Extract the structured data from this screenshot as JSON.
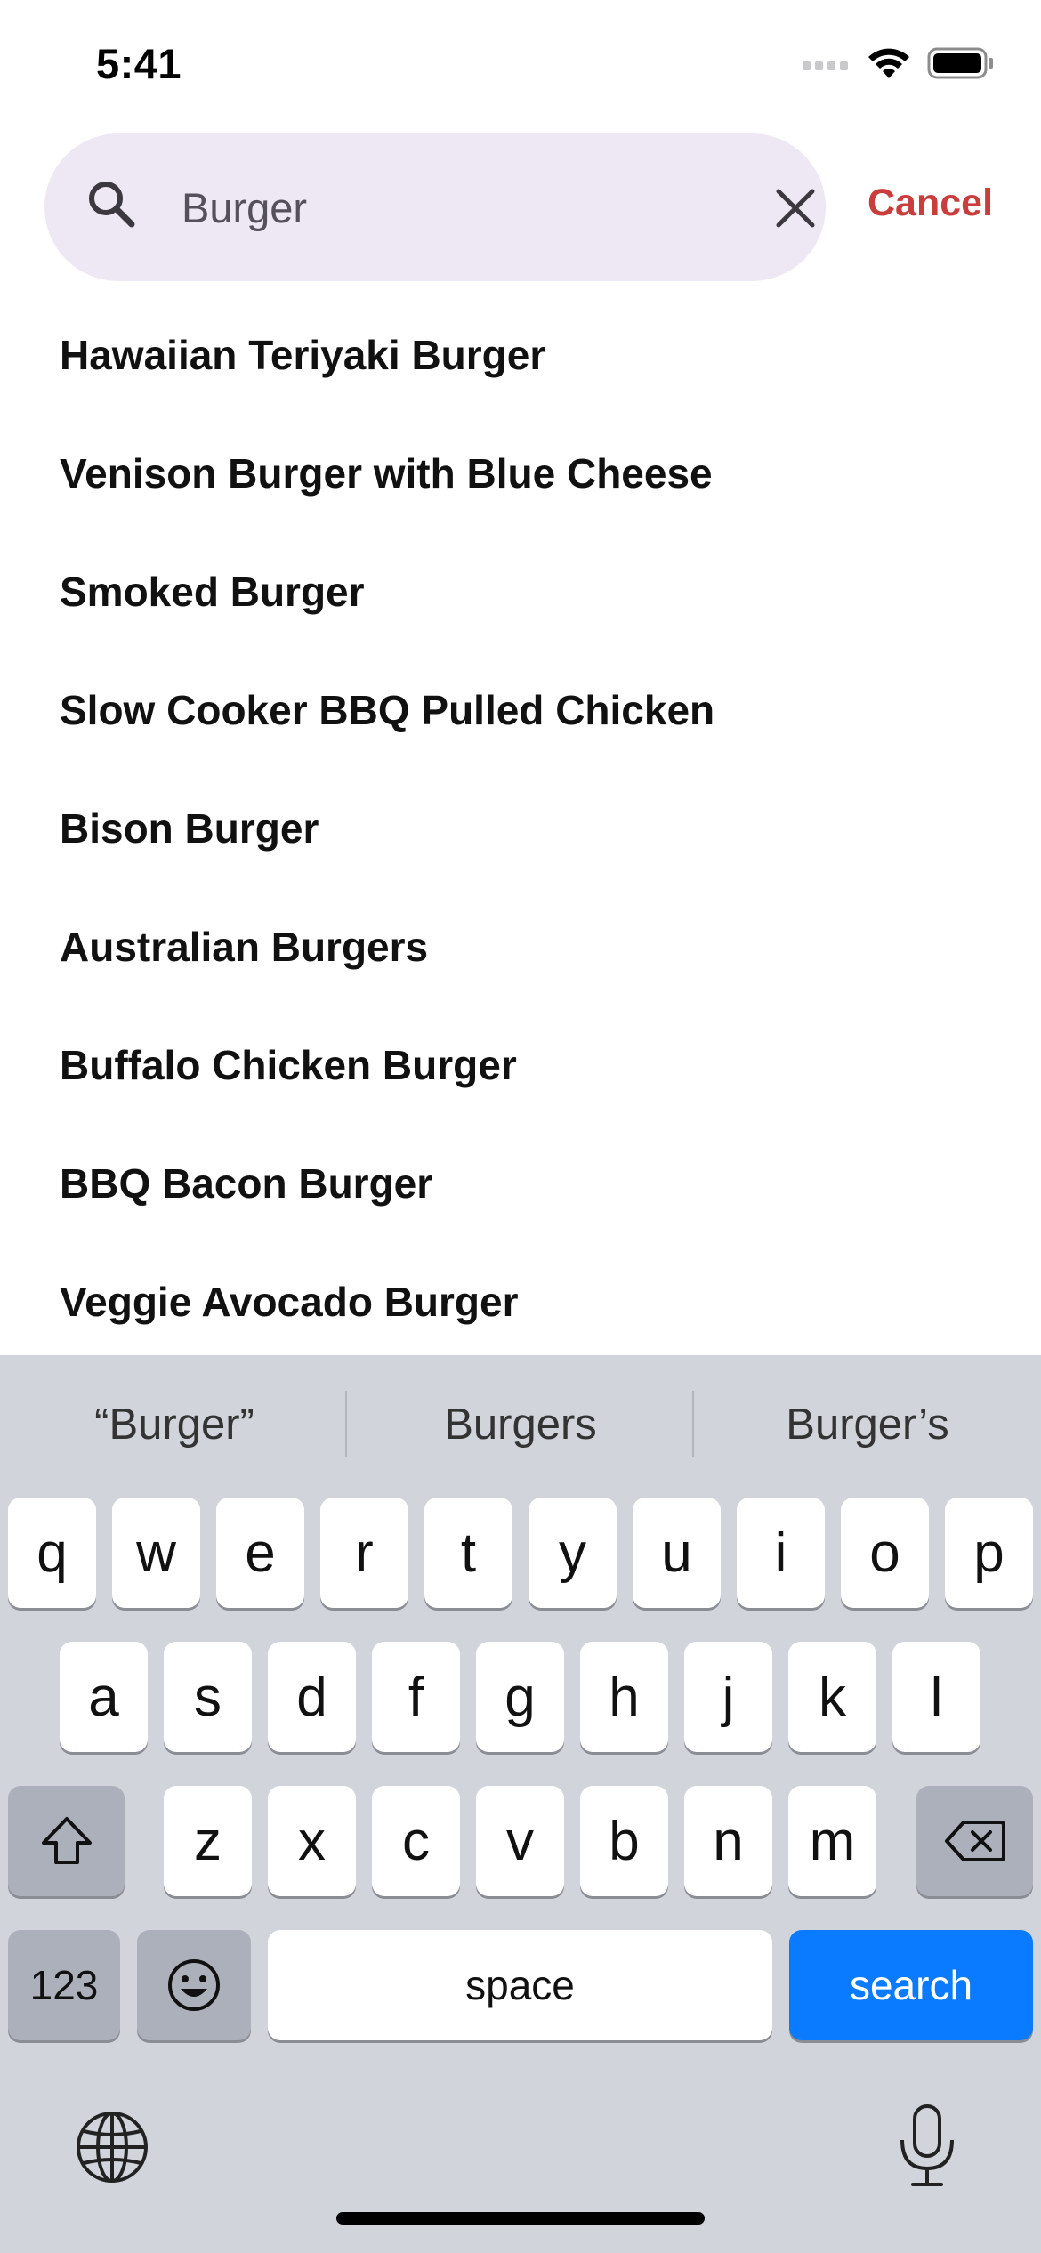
{
  "status": {
    "time": "5:41"
  },
  "search": {
    "query": "Burger",
    "cancel_label": "Cancel"
  },
  "results": [
    "Hawaiian Teriyaki Burger",
    "Venison Burger with Blue Cheese",
    "Smoked Burger",
    "Slow Cooker BBQ Pulled Chicken",
    "Bison Burger",
    "Australian Burgers",
    "Buffalo Chicken Burger",
    "BBQ Bacon Burger",
    "Veggie Avocado Burger"
  ],
  "keyboard": {
    "suggestions": [
      "“Burger”",
      "Burgers",
      "Burger’s"
    ],
    "row1": [
      "q",
      "w",
      "e",
      "r",
      "t",
      "y",
      "u",
      "i",
      "o",
      "p"
    ],
    "row2": [
      "a",
      "s",
      "d",
      "f",
      "g",
      "h",
      "j",
      "k",
      "l"
    ],
    "row3": [
      "z",
      "x",
      "c",
      "v",
      "b",
      "n",
      "m"
    ],
    "numbers_label": "123",
    "space_label": "space",
    "search_label": "search"
  },
  "colors": {
    "accent": "#c93d3d",
    "search_key": "#0a7aff",
    "field_bg": "#ede8f3"
  }
}
